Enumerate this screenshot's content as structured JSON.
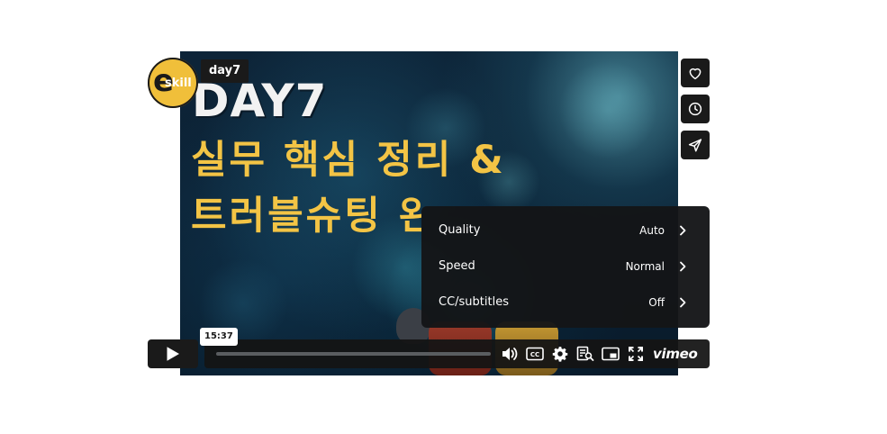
{
  "thumbnail": {
    "day_text": "DAY7",
    "line1": "실무 핵심 정리 &",
    "line2": "트러블슈팅 완성",
    "logo_text": "skill"
  },
  "player": {
    "video_title": "day7",
    "time_tooltip": "15:37",
    "progress_fraction": 0.0,
    "brand": "vimeo"
  },
  "settings_menu": {
    "items": [
      {
        "label": "Quality",
        "value": "Auto"
      },
      {
        "label": "Speed",
        "value": "Normal"
      },
      {
        "label": "CC/subtitles",
        "value": "Off"
      }
    ]
  },
  "side_actions": [
    "heart-icon",
    "clock-icon",
    "send-icon"
  ],
  "controls": [
    "volume-icon",
    "cc-icon",
    "gear-icon",
    "transcript-icon",
    "pip-icon",
    "fullscreen-icon"
  ],
  "colors": {
    "accent_yellow": "#f3c445",
    "annotation_red": "#e53225",
    "panel": "#141517"
  }
}
